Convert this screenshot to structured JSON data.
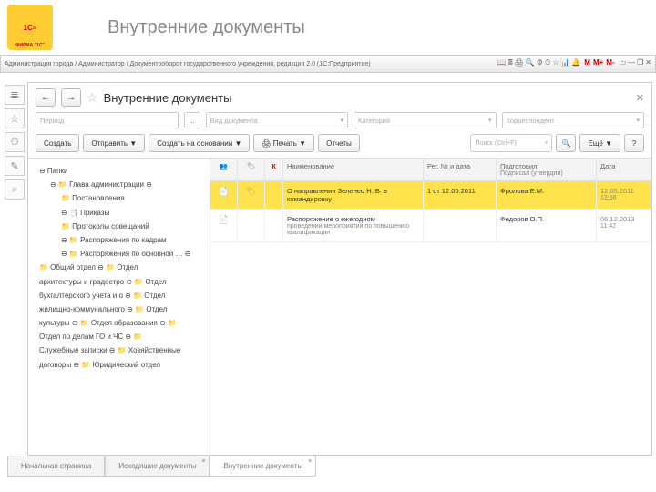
{
  "logo": {
    "brand": "1С=",
    "sub": "ФИРМА \"1С\""
  },
  "page_title": "Внутренние документы",
  "breadcrumb": "Администрация города / Администратор / Документооборот государственного учреждения, редакция 2.0  (1С:Предприятие)",
  "mem_buttons": [
    "M",
    "M+",
    "M-"
  ],
  "sidebar_icons": [
    "≣",
    "☆",
    "⏱",
    "✎",
    "⌕"
  ],
  "nav": {
    "back": "←",
    "fwd": "→"
  },
  "frame_title": "Внутренние документы",
  "filters": {
    "period": "Период",
    "doc_type": "Вид документа",
    "category": "Категория",
    "correspondent": "Корреспондент",
    "ellipsis": "..."
  },
  "toolbar": {
    "create": "Создать",
    "send": "Отправить ▼",
    "create_based": "Создать на основании ▼",
    "print": "🖨 Печать ▼",
    "reports": "Отчеты",
    "search_ph": "Поиск (Ctrl+F)",
    "more": "Ещё ▼",
    "help": "?"
  },
  "tree": [
    {
      "lvl": "n",
      "ic": "ic-g",
      "t": "⊖ Папки"
    },
    {
      "lvl": "n2",
      "ic": "ic-y",
      "t": "⊖ 📁 Глава администрации ⊖"
    },
    {
      "lvl": "n3",
      "ic": "ic-o",
      "t": "📁 Постановления"
    },
    {
      "lvl": "n3",
      "ic": "ic-g",
      "t": "⊖ 📑 Приказы"
    },
    {
      "lvl": "n3",
      "ic": "ic-o",
      "t": "📁 Протоколы совещаний"
    },
    {
      "lvl": "n3",
      "ic": "ic-y",
      "t": "⊖ 📁 Распоряжения по кадрам"
    },
    {
      "lvl": "n3",
      "ic": "ic-o",
      "t": "⊖ 📁 Распоряжения по основной … ⊖"
    },
    {
      "lvl": "n",
      "ic": "ic-o",
      "t": "📁 Общий отдел ⊖ 📁 Отдел"
    },
    {
      "lvl": "n",
      "ic": "",
      "t": "архитектуры и градостро ⊖ 📁 Отдел"
    },
    {
      "lvl": "n",
      "ic": "",
      "t": "бухгалтерского учета и о ⊖ 📁 Отдел"
    },
    {
      "lvl": "n",
      "ic": "",
      "t": "жилищно-коммунального ⊖ 📁 Отдел"
    },
    {
      "lvl": "n",
      "ic": "",
      "t": "культуры ⊖ 📁 Отдел образования ⊖ 📁"
    },
    {
      "lvl": "n",
      "ic": "",
      "t": "Отдел по делам ГО и ЧС ⊖ 📁"
    },
    {
      "lvl": "n",
      "ic": "",
      "t": "Служебные записки ⊖ 📁 Хозяйственные"
    },
    {
      "lvl": "n",
      "ic": "",
      "t": "договоры ⊖ 📁 Юридический отдел"
    }
  ],
  "grid": {
    "head": {
      "ic": "👥",
      "ic2": "🏷",
      "k": "К",
      "name": "Наименование",
      "reg": "Рег. № и дата",
      "who": "Подготовил",
      "who2": "Подписал (утвердил)",
      "date": "Дата"
    },
    "rows": [
      {
        "sel": true,
        "ic": "📄",
        "ic2": "🏷",
        "name": "О направлении Зеленец Н. В. в командировку",
        "reg": "1 от 12.05.2011",
        "who": "Фролова Е.М.",
        "who2": "",
        "date": "12.05.2011",
        "time": "13:56"
      },
      {
        "sel": false,
        "ic": "📄",
        "ic2": "",
        "name": "Распоряжение о ежегодном",
        "name2": "проведении мероприятий по повышению квалификации",
        "reg": "",
        "who": "Федоров О.П.",
        "who2": "",
        "date": "06.12.2013",
        "time": "11:42"
      }
    ]
  },
  "tabs": [
    {
      "label": "Начальная страница",
      "active": false,
      "close": false
    },
    {
      "label": "Исходящие документы",
      "active": false,
      "close": true
    },
    {
      "label": "Внутренние документы",
      "active": true,
      "close": true
    }
  ]
}
